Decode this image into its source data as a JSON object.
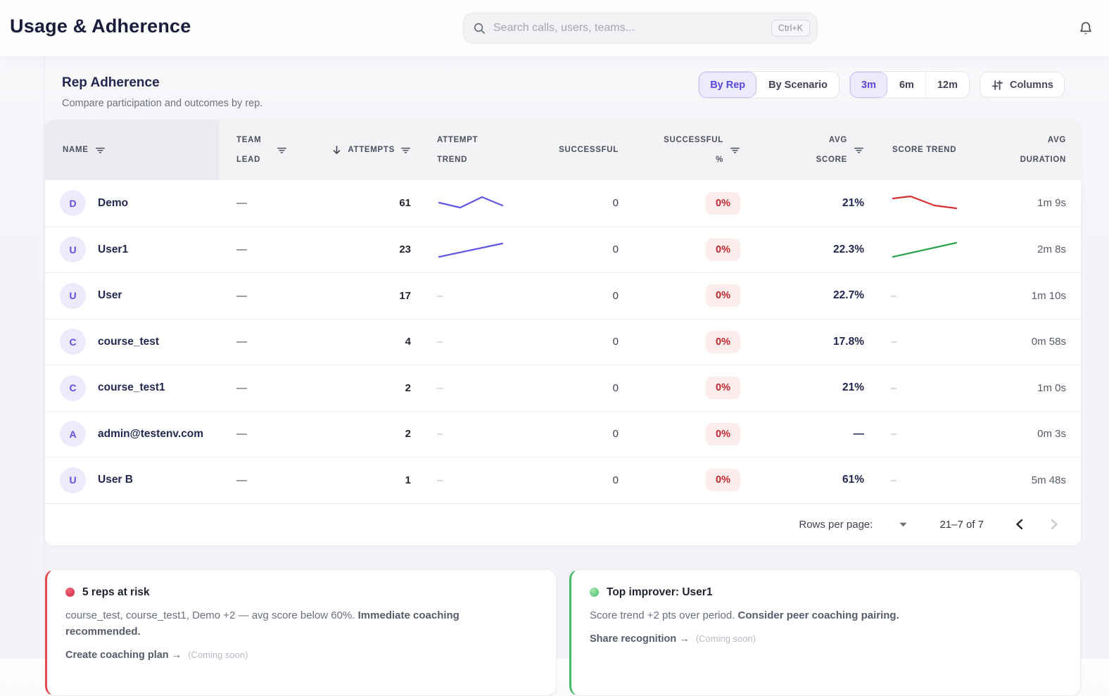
{
  "topbar": {
    "title": "Usage & Adherence",
    "search_placeholder": "Search calls, users, teams...",
    "search_shortcut": "Ctrl+K"
  },
  "section": {
    "title": "Rep Adherence",
    "subtitle": "Compare participation and outcomes by rep.",
    "group_by": [
      {
        "label": "By Rep",
        "active": true
      },
      {
        "label": "By Scenario",
        "active": false
      }
    ],
    "range": [
      {
        "label": "3m",
        "active": true
      },
      {
        "label": "6m",
        "active": false
      },
      {
        "label": "12m",
        "active": false
      }
    ],
    "columns_label": "Columns"
  },
  "table": {
    "headers": {
      "name": "NAME",
      "team_lead": "TEAM LEAD",
      "attempts": "ATTEMPTS",
      "attempt_trend": "ATTEMPT TREND",
      "successful": "SUCCESSFUL",
      "successful_pct": "SUCCESSFUL %",
      "avg_score": "AVG SCORE",
      "score_trend": "SCORE TREND",
      "avg_duration": "AVG DURATION"
    },
    "rows": [
      {
        "initial": "D",
        "name": "Demo",
        "team_lead": "—",
        "attempts": "61",
        "attempt_trend": {
          "color": "#6356e5",
          "points": [
            [
              3,
              15
            ],
            [
              33,
              22
            ],
            [
              64,
              7
            ],
            [
              93,
              19
            ]
          ]
        },
        "successful": "0",
        "successful_pct": "0%",
        "avg_score": "21%",
        "score_trend": {
          "color": "#d2302f",
          "points": [
            [
              3,
              9
            ],
            [
              28,
              6
            ],
            [
              62,
              19
            ],
            [
              93,
              23
            ]
          ]
        },
        "avg_duration": "1m 9s"
      },
      {
        "initial": "U",
        "name": "User1",
        "team_lead": "—",
        "attempts": "23",
        "attempt_trend": {
          "color": "#6356e5",
          "points": [
            [
              3,
              26
            ],
            [
              93,
              7
            ]
          ]
        },
        "successful": "0",
        "successful_pct": "0%",
        "avg_score": "22.3%",
        "score_trend": {
          "color": "#2aa24b",
          "points": [
            [
              3,
              26
            ],
            [
              93,
              6
            ]
          ]
        },
        "avg_duration": "2m 8s"
      },
      {
        "initial": "U",
        "name": "User",
        "team_lead": "—",
        "attempts": "17",
        "attempt_trend": null,
        "successful": "0",
        "successful_pct": "0%",
        "avg_score": "22.7%",
        "score_trend": null,
        "avg_duration": "1m 10s"
      },
      {
        "initial": "C",
        "name": "course_test",
        "team_lead": "—",
        "attempts": "4",
        "attempt_trend": null,
        "successful": "0",
        "successful_pct": "0%",
        "avg_score": "17.8%",
        "score_trend": null,
        "avg_duration": "0m 58s"
      },
      {
        "initial": "C",
        "name": "course_test1",
        "team_lead": "—",
        "attempts": "2",
        "attempt_trend": null,
        "successful": "0",
        "successful_pct": "0%",
        "avg_score": "21%",
        "score_trend": null,
        "avg_duration": "1m 0s"
      },
      {
        "initial": "A",
        "name": "admin@testenv.com",
        "team_lead": "—",
        "attempts": "2",
        "attempt_trend": null,
        "successful": "0",
        "successful_pct": "0%",
        "avg_score": "—",
        "score_trend": null,
        "avg_duration": "0m 3s"
      },
      {
        "initial": "U",
        "name": "User B",
        "team_lead": "—",
        "attempts": "1",
        "attempt_trend": null,
        "successful": "0",
        "successful_pct": "0%",
        "avg_score": "61%",
        "score_trend": null,
        "avg_duration": "5m 48s"
      }
    ],
    "pagination": {
      "rows_per_page_label": "Rows per page:",
      "range_label": "21–7 of 7"
    }
  },
  "insights": [
    {
      "title": "5 reps at risk",
      "body": "course_test, course_test1, Demo +2 — avg score below 60%. ",
      "body_strong": "Immediate coaching recommended.",
      "link": "Create coaching plan →",
      "coming_soon": "(Coming soon)"
    },
    {
      "title": "Top improver: User1",
      "body": "Score trend +2 pts over period. ",
      "body_strong": "Consider peer coaching pairing.",
      "link": "Share recognition →",
      "coming_soon": "(Coming soon)"
    }
  ],
  "colors": {
    "accent_purple": "#5847e0",
    "accent_purple_bg": "#eceafb",
    "badge_red_text": "#c1282e",
    "badge_red_bg": "#fdecec",
    "spark_purple": "#6356e5",
    "spark_red": "#d2302f",
    "spark_green": "#2aa24b",
    "risk_accent": "#e5484d",
    "improve_accent": "#44bc64"
  }
}
